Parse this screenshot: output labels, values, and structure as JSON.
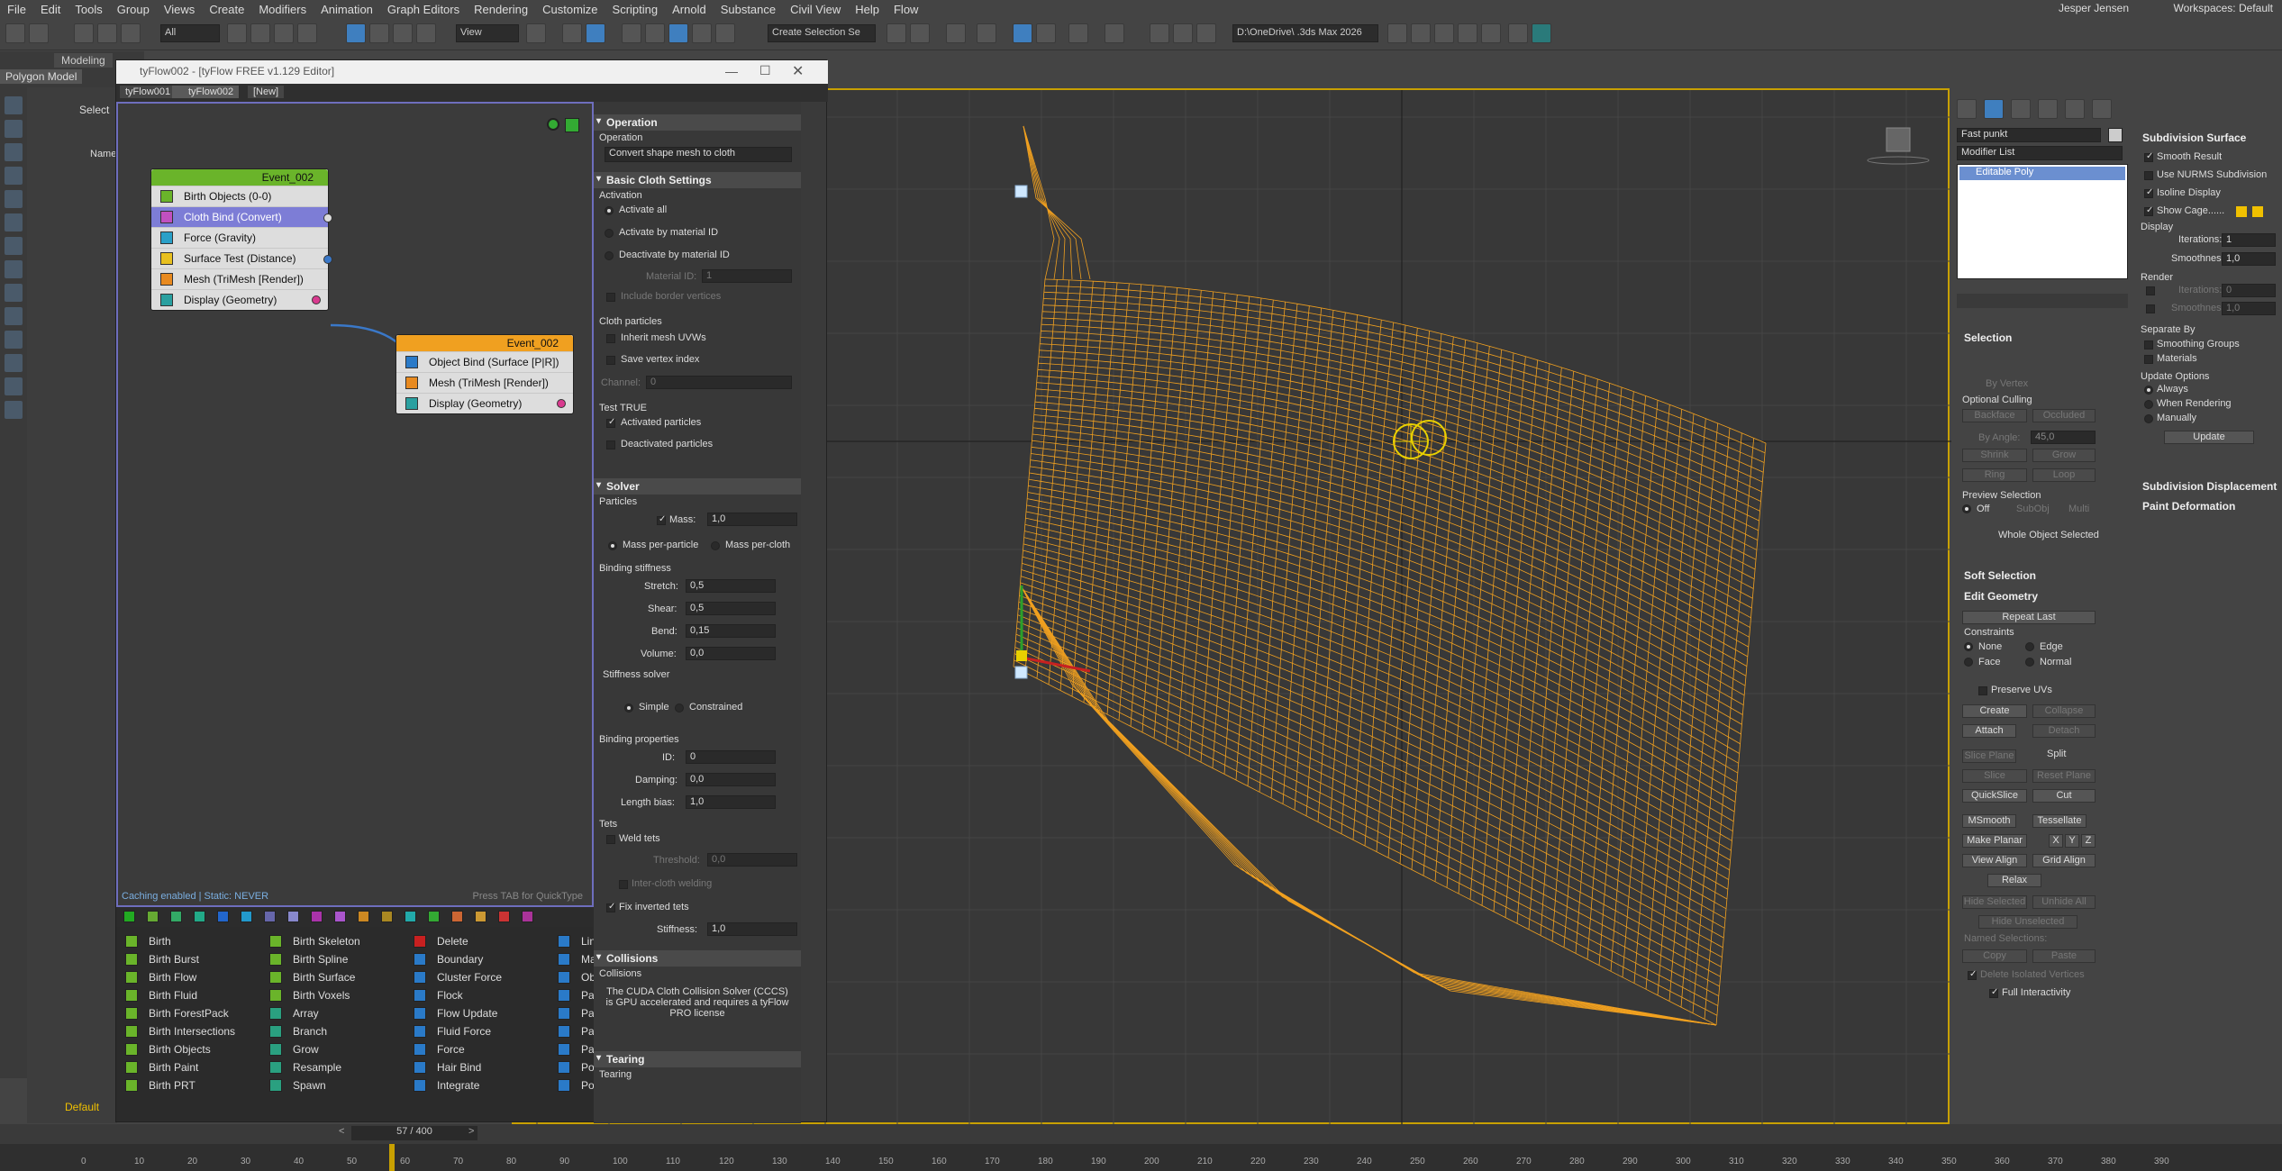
{
  "menu": [
    "File",
    "Edit",
    "Tools",
    "Group",
    "Views",
    "Create",
    "Modifiers",
    "Animation",
    "Graph Editors",
    "Rendering",
    "Customize",
    "Scripting",
    "Arnold",
    "Substance",
    "Civil View",
    "Help",
    "Flow"
  ],
  "user": "Jesper Jensen",
  "workspace": "Workspaces: Default",
  "toolbar": {
    "selection_filter": "All",
    "ref_coord": "View",
    "named_sel": "Create Selection Se",
    "project_path": "D:\\OneDrive\\ .3ds Max 2026"
  },
  "ribbon": {
    "modeling": "Modeling",
    "polygon_modeling": "Polygon Model"
  },
  "scene": {
    "select": "Select",
    "name_col": "Name"
  },
  "tyflow": {
    "title": "tyFlow002 - [tyFlow FREE v1.129 Editor]",
    "tabs": [
      "tyFlow001",
      "tyFlow002",
      "[New]"
    ],
    "events": [
      {
        "name": "Event_002",
        "color": "#6ab42a",
        "ops": [
          "Birth Objects (0-0)",
          "Cloth Bind (Convert)",
          "Force (Gravity)",
          "Surface Test (Distance)",
          "Mesh (TriMesh [Render])",
          "Display (Geometry)"
        ]
      },
      {
        "name": "Event_002",
        "color": "#f0a020",
        "ops": [
          "Object Bind (Surface [P|R])",
          "Mesh (TriMesh [Render])",
          "Display (Geometry)"
        ]
      }
    ],
    "status": "Caching enabled | Static: NEVER",
    "hint": "Press TAB for QuickType",
    "oplist": {
      "col1": [
        "Birth",
        "Birth Burst",
        "Birth Flow",
        "Birth Fluid",
        "Birth ForestPack",
        "Birth Intersections",
        "Birth Objects",
        "Birth Paint",
        "Birth PRT"
      ],
      "col2": [
        "Birth Skeleton",
        "Birth Spline",
        "Birth Surface",
        "Birth Voxels",
        "Array",
        "Branch",
        "Grow",
        "Resample",
        "Spawn"
      ],
      "col3": [
        "Delete",
        "Boundary",
        "Cluster Force",
        "Flock",
        "Flow Update",
        "Fluid Force",
        "Force",
        "Hair Bind",
        "Integrate"
      ],
      "col4": [
        "Lin",
        "Ma",
        "Ob",
        "Pa",
        "Pa",
        "Pa",
        "Pa",
        "Po",
        "Po"
      ]
    }
  },
  "props": {
    "operation": {
      "title": "Operation",
      "label": "Operation",
      "value": "Convert shape mesh to cloth"
    },
    "basic": {
      "title": "Basic Cloth Settings",
      "activation": "Activation",
      "a1": "Activate all",
      "a2": "Activate by material ID",
      "a3": "Deactivate by material ID",
      "matid": "Material ID:",
      "matid_val": "1",
      "border": "Include border vertices",
      "cloth_particles": "Cloth particles",
      "inherit": "Inherit mesh UVWs",
      "save": "Save vertex index",
      "channel": "Channel:",
      "channel_val": "0",
      "test": "Test TRUE",
      "activated": "Activated particles",
      "deactivated": "Deactivated particles"
    },
    "solver": {
      "title": "Solver",
      "particles": "Particles",
      "mass": "Mass:",
      "mass_val": "1,0",
      "mpp": "Mass per-particle",
      "mpc": "Mass per-cloth",
      "binding": "Binding stiffness",
      "stretch": "Stretch:",
      "stretch_val": "0,5",
      "shear": "Shear:",
      "shear_val": "0,5",
      "bend": "Bend:",
      "bend_val": "0,15",
      "volume": "Volume:",
      "volume_val": "0,0",
      "stiffsolver": "Stiffness solver",
      "simple": "Simple",
      "constrained": "Constrained",
      "bprops": "Binding properties",
      "id": "ID:",
      "id_val": "0",
      "damping": "Damping:",
      "damping_val": "0,0",
      "lbias": "Length bias:",
      "lbias_val": "1,0",
      "tets": "Tets",
      "weld": "Weld tets",
      "threshold": "Threshold:",
      "threshold_val": "0,0",
      "inter": "Inter-cloth welding",
      "fix": "Fix inverted tets",
      "stiffness": "Stiffness:",
      "stiffness_val": "1,0"
    },
    "collisions": {
      "title": "Collisions",
      "label": "Collisions",
      "note": "The CUDA Cloth Collision Solver (CCCS) is GPU accelerated and requires a tyFlow PRO license"
    },
    "tearing": {
      "title": "Tearing",
      "label": "Tearing"
    }
  },
  "command": {
    "object_name": "Fast punkt",
    "modifier_list": "Modifier List",
    "stack_item": "Editable Poly",
    "selection": {
      "title": "Selection",
      "by_vertex": "By Vertex",
      "opt_culling": "Optional Culling",
      "backface": "Backface",
      "occluded": "Occluded",
      "by_angle": "By Angle:",
      "by_angle_val": "45,0",
      "shrink": "Shrink",
      "grow": "Grow",
      "ring": "Ring",
      "loop": "Loop",
      "preview": "Preview Selection",
      "off": "Off",
      "subobj": "SubObj",
      "multi": "Multi",
      "whole": "Whole Object Selected"
    },
    "soft": "Soft Selection",
    "edit_geom": {
      "title": "Edit Geometry",
      "repeat": "Repeat Last",
      "constraints": "Constraints",
      "none": "None",
      "edge": "Edge",
      "face": "Face",
      "normal": "Normal",
      "preserve": "Preserve UVs",
      "create": "Create",
      "collapse": "Collapse",
      "attach": "Attach",
      "detach": "Detach",
      "slice_plane": "Slice Plane",
      "split": "Split",
      "slice": "Slice",
      "reset_plane": "Reset Plane",
      "quickslice": "QuickSlice",
      "cut": "Cut",
      "msmooth": "MSmooth",
      "tessellate": "Tessellate",
      "make_planar": "Make Planar",
      "x": "X",
      "y": "Y",
      "z": "Z",
      "view_align": "View Align",
      "grid_align": "Grid Align",
      "relax": "Relax",
      "hide_sel": "Hide Selected",
      "unhide_all": "Unhide All",
      "hide_unsel": "Hide Unselected",
      "named": "Named Selections:",
      "copy": "Copy",
      "paste": "Paste",
      "delete_iso": "Delete Isolated Vertices",
      "full_inter": "Full Interactivity"
    },
    "subdiv": {
      "title": "Subdivision Surface",
      "smooth_result": "Smooth Result",
      "nurms": "Use NURMS Subdivision",
      "isoline": "Isoline Display",
      "cage": "Show Cage......",
      "display": "Display",
      "iterations": "Iterations:",
      "iter_val": "1",
      "smoothness": "Smoothness:",
      "smooth_val": "1,0",
      "render": "Render",
      "r_iter": "Iterations:",
      "r_iter_val": "0",
      "r_smooth": "Smoothness:",
      "r_smooth_val": "1,0",
      "separate": "Separate By",
      "sm_groups": "Smoothing Groups",
      "materials": "Materials",
      "update_opts": "Update Options",
      "always": "Always",
      "when_render": "When Rendering",
      "manually": "Manually",
      "update": "Update"
    },
    "sub_disp": "Subdivision Displacement",
    "paint_def": "Paint Deformation"
  },
  "timeline": {
    "frame": "57 / 400",
    "ticks": [
      "0",
      "10",
      "20",
      "30",
      "40",
      "50",
      "60",
      "70",
      "80",
      "90",
      "100",
      "110",
      "120",
      "130",
      "140",
      "150",
      "160",
      "170",
      "180",
      "190",
      "200",
      "210",
      "220",
      "230",
      "240",
      "250",
      "260",
      "270",
      "280",
      "290",
      "300",
      "310",
      "320",
      "330",
      "340",
      "350",
      "360",
      "370",
      "380",
      "390"
    ],
    "default": "Default"
  }
}
